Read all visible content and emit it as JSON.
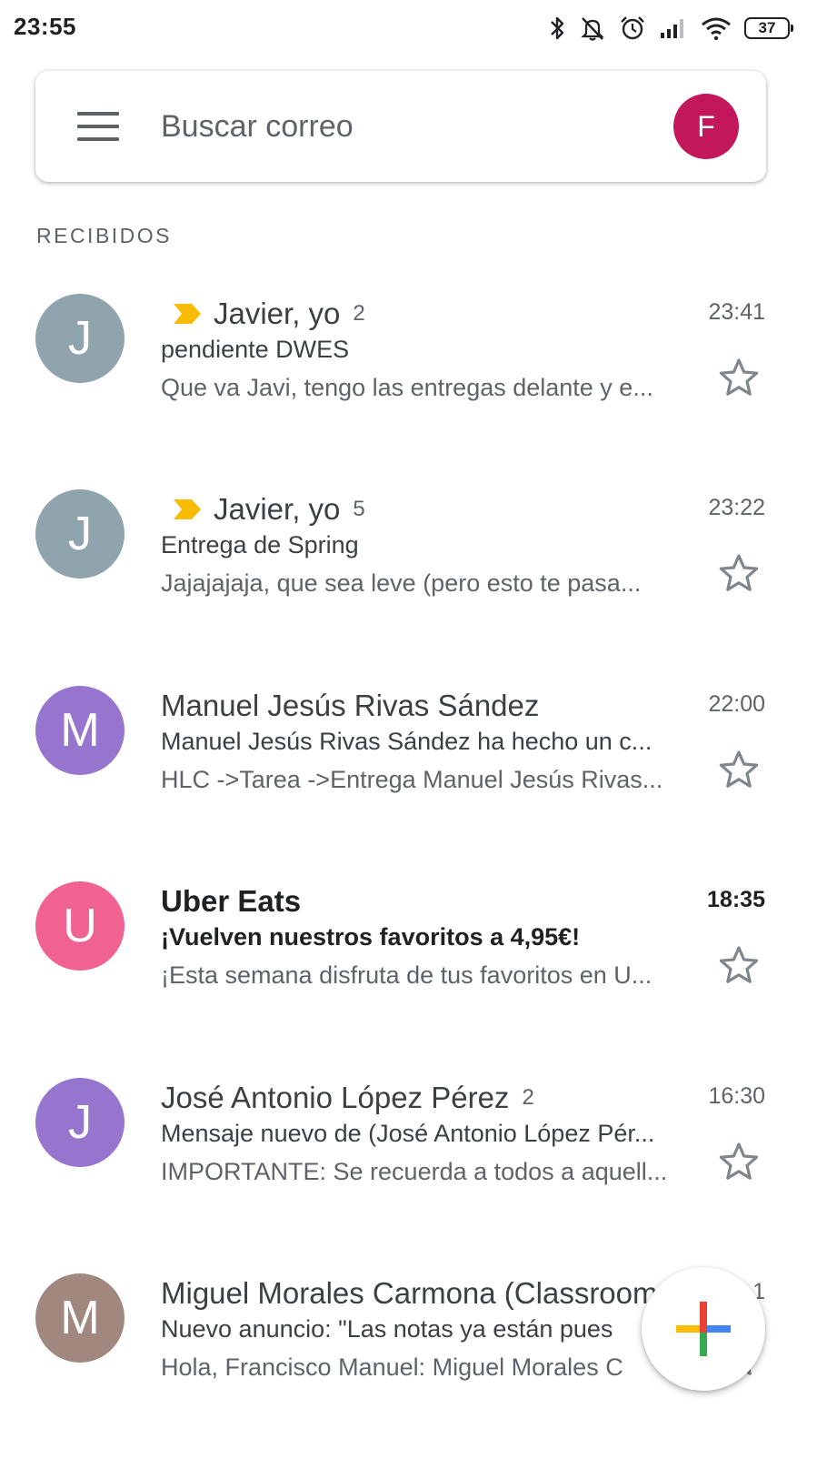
{
  "status_bar": {
    "time": "23:55",
    "battery": "37",
    "icons": [
      "bluetooth-icon",
      "mute-icon",
      "alarm-icon",
      "signal-icon",
      "wifi-icon",
      "battery-icon"
    ]
  },
  "search": {
    "menu_icon": "hamburger-menu-icon",
    "placeholder": "Buscar correo",
    "account_initial": "F",
    "account_color": "#c2185b"
  },
  "section_label": "RECIBIDOS",
  "emails": [
    {
      "initial": "J",
      "avatar_color": "#90a4ae",
      "important": true,
      "sender": "Javier, yo",
      "count": "2",
      "time": "23:41",
      "subject": "pendiente DWES",
      "snippet": "Que va Javi, tengo las entregas delante y e...",
      "unread": false
    },
    {
      "initial": "J",
      "avatar_color": "#90a4ae",
      "important": true,
      "sender": "Javier, yo",
      "count": "5",
      "time": "23:22",
      "subject": "Entrega de Spring",
      "snippet": "Jajajajaja, que sea leve (pero esto te pasa...",
      "unread": false
    },
    {
      "initial": "M",
      "avatar_color": "#9575cd",
      "important": false,
      "sender": "Manuel Jesús Rivas Sández",
      "count": "",
      "time": "22:00",
      "subject": "Manuel Jesús Rivas Sández ha hecho un c...",
      "snippet": "HLC ->Tarea ->Entrega Manuel Jesús Rivas...",
      "unread": false
    },
    {
      "initial": "U",
      "avatar_color": "#f06292",
      "important": false,
      "sender": "Uber Eats",
      "count": "",
      "time": "18:35",
      "subject": "¡Vuelven nuestros favoritos a 4,95€!",
      "snippet": "¡Esta semana disfruta de tus favoritos en U...",
      "unread": true
    },
    {
      "initial": "J",
      "avatar_color": "#9575cd",
      "important": false,
      "sender": "José Antonio López Pérez",
      "count": "2",
      "time": "16:30",
      "subject": "Mensaje nuevo de (José Antonio López Pér...",
      "snippet": "IMPORTANTE: Se recuerda a todos a aquell...",
      "unread": false
    },
    {
      "initial": "M",
      "avatar_color": "#a1887f",
      "important": false,
      "sender": "Miguel Morales Carmona (Classroom",
      "count": "",
      "time": "1",
      "subject": "Nuevo anuncio: \"Las notas ya están pues",
      "snippet": "Hola, Francisco Manuel: Miguel Morales C",
      "unread": false
    }
  ],
  "fab": {
    "icon": "compose-plus-icon"
  }
}
